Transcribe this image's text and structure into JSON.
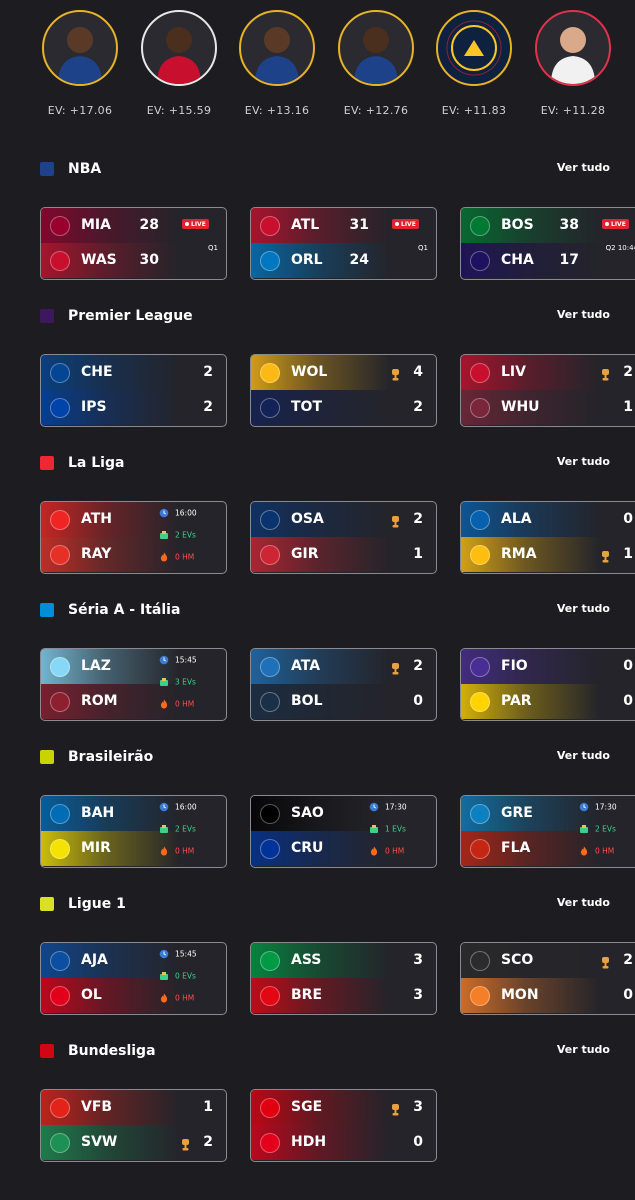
{
  "players": [
    {
      "ev": "EV: +17.06",
      "border": "#e9b326",
      "jersey": "#1d428a",
      "skin": "#5a3a27"
    },
    {
      "ev": "EV: +15.59",
      "border": "#e8e8e8",
      "jersey": "#c8102e",
      "skin": "#4a2e1e"
    },
    {
      "ev": "EV: +13.16",
      "border": "#e9b326",
      "jersey": "#1d428a",
      "skin": "#5a3a27"
    },
    {
      "ev": "EV: +12.76",
      "border": "#e9b326",
      "jersey": "#1d428a",
      "skin": "#4a2e1e"
    },
    {
      "ev": "EV: +11.83",
      "border": "#e9b326",
      "jersey": "#0e2240",
      "skin": ""
    },
    {
      "ev": "EV: +11.28",
      "border": "#e0334b",
      "jersey": "#f1f1f1",
      "skin": "#d9a98a"
    }
  ],
  "view_all_label": "Ver tudo",
  "sections": [
    {
      "title": "NBA",
      "icon_color": "#1d428a",
      "cards": [
        {
          "live": true,
          "live_label": "LIVE",
          "period": "Q1",
          "home": {
            "abbr": "MIA",
            "score": "28",
            "color": "#98002e"
          },
          "away": {
            "abbr": "WAS",
            "score": "30",
            "color": "#c8102e"
          }
        },
        {
          "live": true,
          "live_label": "LIVE",
          "period": "Q1",
          "home": {
            "abbr": "ATL",
            "score": "31",
            "color": "#c8102e"
          },
          "away": {
            "abbr": "ORL",
            "score": "24",
            "color": "#0077c0"
          }
        },
        {
          "live": true,
          "live_label": "LIVE",
          "period": "Q2 10:44",
          "home": {
            "abbr": "BOS",
            "score": "38",
            "color": "#007a33"
          },
          "away": {
            "abbr": "CHA",
            "score": "17",
            "color": "#1d1160"
          }
        }
      ]
    },
    {
      "title": "Premier League",
      "icon_color": "#3d195b",
      "cards": [
        {
          "home": {
            "abbr": "CHE",
            "score": "2",
            "color": "#034694"
          },
          "away": {
            "abbr": "IPS",
            "score": "2",
            "color": "#0044a9"
          }
        },
        {
          "home": {
            "abbr": "WOL",
            "score": "4",
            "color": "#fdb913",
            "trophy": true
          },
          "away": {
            "abbr": "TOT",
            "score": "2",
            "color": "#132257"
          }
        },
        {
          "home": {
            "abbr": "LIV",
            "score": "2",
            "color": "#c8102e",
            "trophy": true
          },
          "away": {
            "abbr": "WHU",
            "score": "1",
            "color": "#7a263a"
          }
        }
      ]
    },
    {
      "title": "La Liga",
      "icon_color": "#ee2737",
      "cards": [
        {
          "time": "16:00",
          "evs": "2 EVs",
          "hm": "0 HM",
          "home": {
            "abbr": "ATH",
            "color": "#ee2523"
          },
          "away": {
            "abbr": "RAY",
            "color": "#e53027"
          }
        },
        {
          "home": {
            "abbr": "OSA",
            "score": "2",
            "color": "#0a346f",
            "trophy": true
          },
          "away": {
            "abbr": "GIR",
            "score": "1",
            "color": "#cd2534"
          }
        },
        {
          "home": {
            "abbr": "ALA",
            "score": "0",
            "color": "#0761af"
          },
          "away": {
            "abbr": "RMA",
            "score": "1",
            "color": "#febe10",
            "trophy": true
          }
        }
      ]
    },
    {
      "title": "Séria A - Itália",
      "icon_color": "#008fd7",
      "cards": [
        {
          "time": "15:45",
          "evs": "3 EVs",
          "hm": "0 HM",
          "home": {
            "abbr": "LAZ",
            "color": "#87d8f7"
          },
          "away": {
            "abbr": "ROM",
            "color": "#8e1f2f"
          }
        },
        {
          "home": {
            "abbr": "ATA",
            "score": "2",
            "color": "#1e71b8",
            "trophy": true
          },
          "away": {
            "abbr": "BOL",
            "score": "0",
            "color": "#1a2f48"
          }
        },
        {
          "home": {
            "abbr": "FIO",
            "score": "0",
            "color": "#482e92"
          },
          "away": {
            "abbr": "PAR",
            "score": "0",
            "color": "#ffd200"
          }
        }
      ]
    },
    {
      "title": "Brasileirão",
      "icon_color": "#c8d400",
      "cards": [
        {
          "time": "16:00",
          "evs": "2 EVs",
          "hm": "0 HM",
          "home": {
            "abbr": "BAH",
            "color": "#006cb5"
          },
          "away": {
            "abbr": "MIR",
            "color": "#f4e203"
          }
        },
        {
          "time": "17:30",
          "evs": "1 EVs",
          "hm": "0 HM",
          "home": {
            "abbr": "SAO",
            "color": "#000000"
          },
          "away": {
            "abbr": "CRU",
            "color": "#003399"
          }
        },
        {
          "time": "17:30",
          "evs": "2 EVs",
          "hm": "0 HM",
          "home": {
            "abbr": "GRE",
            "color": "#0d80bf"
          },
          "away": {
            "abbr": "FLA",
            "color": "#c52613"
          }
        }
      ]
    },
    {
      "title": "Ligue 1",
      "icon_color": "#dae025",
      "cards": [
        {
          "time": "15:45",
          "evs": "0 EVs",
          "hm": "0 HM",
          "home": {
            "abbr": "AJA",
            "color": "#0b4ea2"
          },
          "away": {
            "abbr": "OL",
            "color": "#e2001a"
          }
        },
        {
          "home": {
            "abbr": "ASS",
            "score": "3",
            "color": "#009a44"
          },
          "away": {
            "abbr": "BRE",
            "score": "3",
            "color": "#e30613"
          }
        },
        {
          "home": {
            "abbr": "SCO",
            "score": "2",
            "color": "#2b2b2b",
            "trophy": true
          },
          "away": {
            "abbr": "MON",
            "score": "0",
            "color": "#f57f29"
          }
        }
      ]
    },
    {
      "title": "Bundesliga",
      "icon_color": "#d20515",
      "cards": [
        {
          "home": {
            "abbr": "VFB",
            "score": "1",
            "color": "#e32219"
          },
          "away": {
            "abbr": "SVW",
            "score": "2",
            "color": "#1d9053",
            "trophy": true
          }
        },
        {
          "home": {
            "abbr": "SGE",
            "score": "3",
            "color": "#e1000f",
            "trophy": true
          },
          "away": {
            "abbr": "HDH",
            "score": "0",
            "color": "#e2001a"
          }
        }
      ]
    }
  ]
}
